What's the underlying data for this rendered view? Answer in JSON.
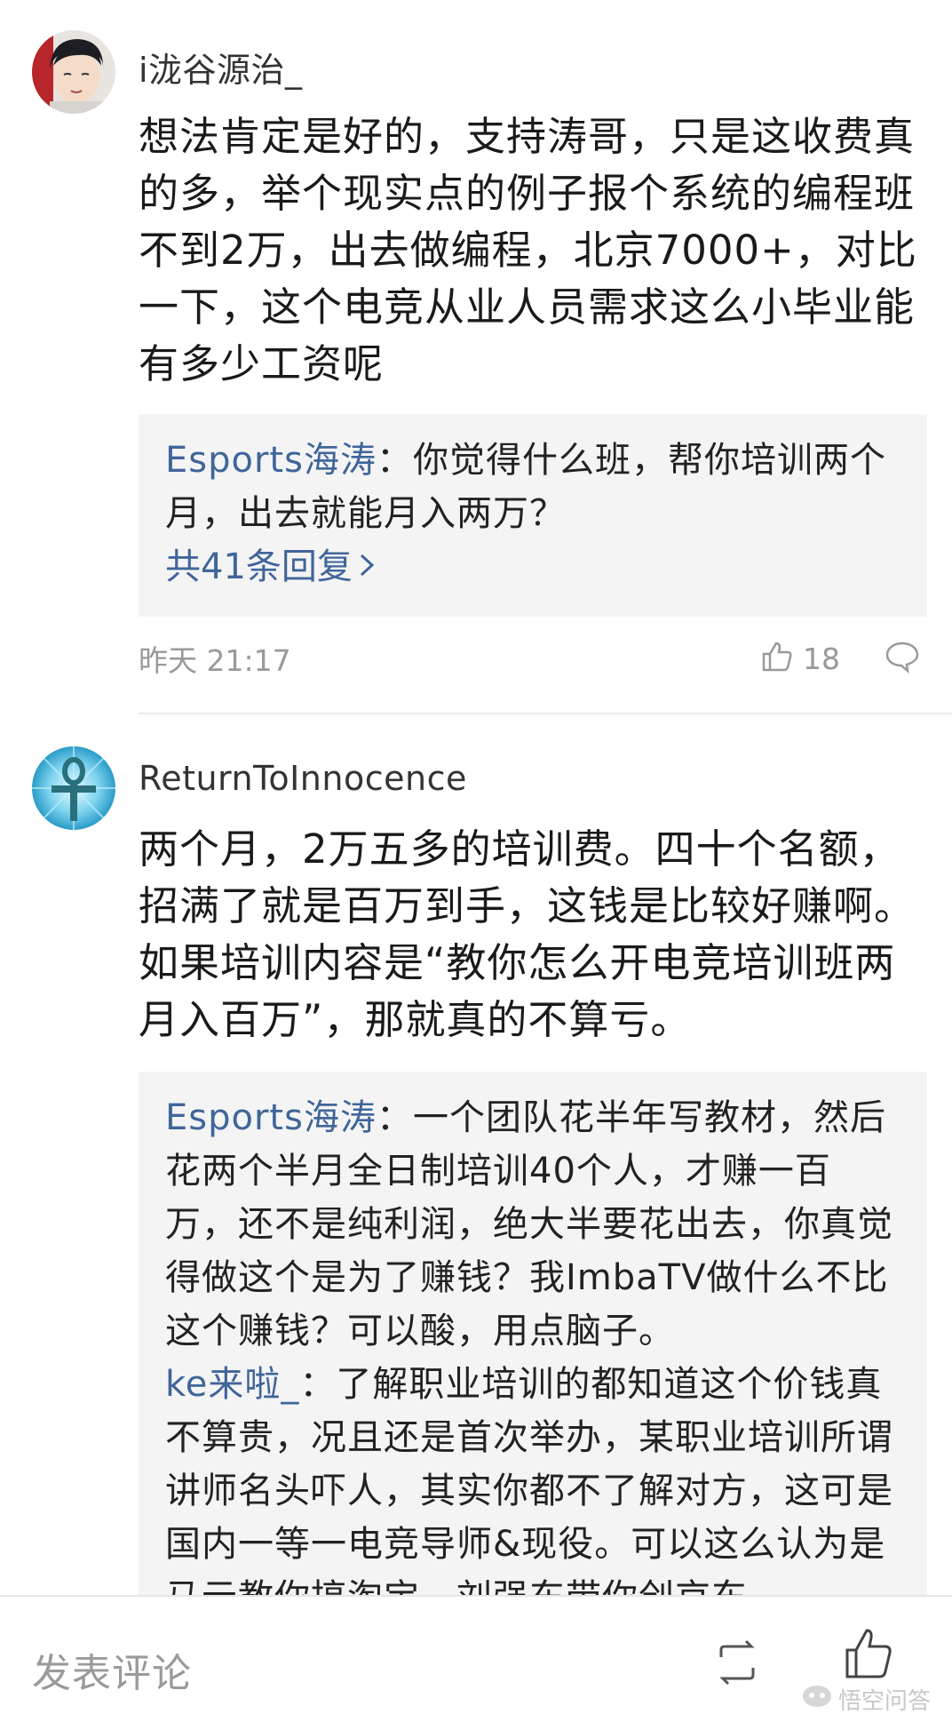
{
  "comments": [
    {
      "username": "i泷谷源治_",
      "text": "想法肯定是好的，支持涛哥，只是这收费真的多，举个现实点的例子报个系统的编程班不到2万，出去做编程，北京7000+，对比一下，这个电竞从业人员需求这么小毕业能有多少工资呢",
      "replies": [
        {
          "name": "Esports海涛",
          "sep": "：",
          "text": "你觉得什么班，帮你培训两个月，出去就能月入两万？"
        }
      ],
      "more_replies": "共41条回复",
      "time": "昨天 21:17",
      "likes": "18"
    },
    {
      "username": "ReturnToInnocence",
      "text": "两个月，2万五多的培训费。四十个名额，招满了就是百万到手，这钱是比较好赚啊。如果培训内容是“教你怎么开电竞培训班两月入百万”，那就真的不算亏。",
      "replies": [
        {
          "name": "Esports海涛",
          "sep": "：",
          "text": "一个团队花半年写教材，然后花两个半月全日制培训40个人，才赚一百万，还不是纯利润，绝大半要花出去，你真觉得做这个是为了赚钱？我ImbaTV做什么不比这个赚钱？可以酸，用点脑子。"
        },
        {
          "name": "ke来啦_",
          "sep": "：",
          "text": "了解职业培训的都知道这个价钱真不算贵，况且还是首次举办，某职业培训所谓讲师名头吓人，其实你都不了解对方，这可是国内一等一电竞导师&现役。可以这么认为是马云教你搞淘宝，刘强东带你创京东"
        }
      ]
    }
  ],
  "bottom_bar": {
    "input_placeholder": "发表评论",
    "watermark": "悟空问答"
  },
  "colors": {
    "link": "#406599",
    "reply_bg": "#f4f4f5",
    "muted": "#999999"
  },
  "icons": [
    "thumb-up-icon",
    "comment-bubble-icon",
    "share-icon",
    "like-icon",
    "wukong-logo-icon"
  ]
}
